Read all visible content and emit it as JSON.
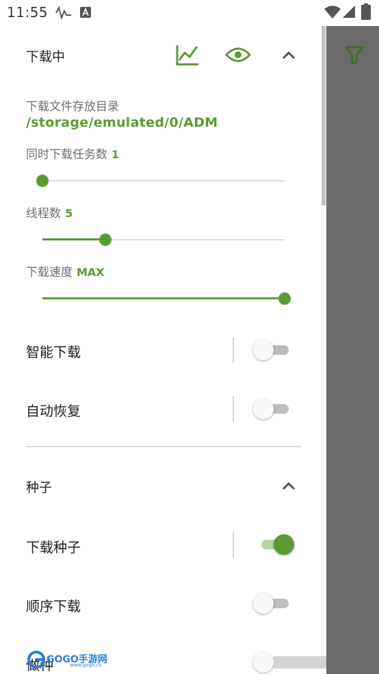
{
  "status_bar": {
    "time": "11:55",
    "icons": [
      "signal-activity-icon",
      "a-badge-icon",
      "wifi-icon",
      "cell-signal-icon",
      "battery-icon"
    ]
  },
  "toolbar": {
    "filter_icon": "filter-icon"
  },
  "download_section": {
    "title": "下载中",
    "icons": [
      "chart-icon",
      "eye-icon",
      "chevron-up-icon"
    ],
    "dir_label": "下载文件存放目录",
    "dir_path": "/storage/emulated/0/ADM",
    "simultaneous": {
      "label": "同时下载任务数",
      "value": "1",
      "fraction": 0.0
    },
    "threads": {
      "label": "线程数",
      "value": "5",
      "fraction": 0.26
    },
    "speed": {
      "label": "下载速度",
      "value": "MAX",
      "fraction": 1.0
    },
    "smart_download": {
      "label": "智能下载",
      "checked": false
    },
    "auto_resume": {
      "label": "自动恢复",
      "checked": false
    }
  },
  "torrent_section": {
    "title": "种子",
    "icons": [
      "chevron-up-icon"
    ],
    "download_torrent": {
      "label": "下载种子",
      "checked": true
    },
    "sequential_download": {
      "label": "顺序下载",
      "checked": false
    },
    "partial_row": {
      "label": "做种",
      "checked": false
    }
  },
  "watermark": {
    "text": "GOGO手游网",
    "sub": "www.gogo.cn"
  },
  "colors": {
    "accent": "#5b9a33",
    "scrim": "#6b6b6b",
    "label": "#6d6d6d"
  }
}
